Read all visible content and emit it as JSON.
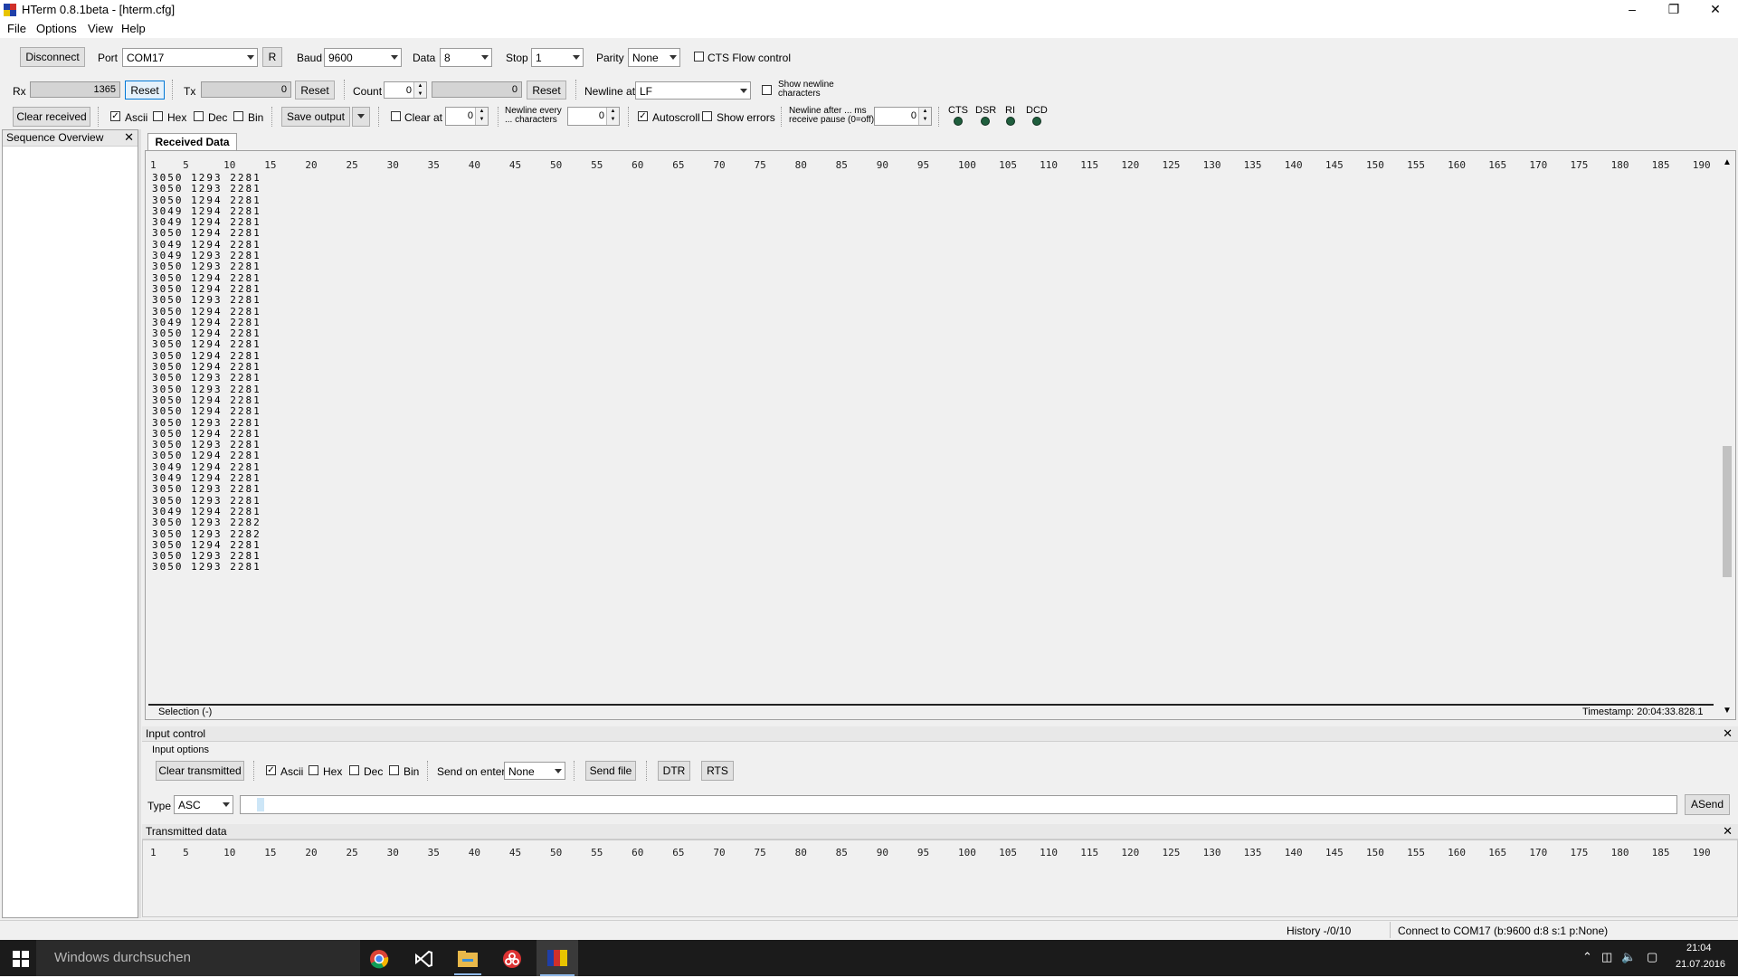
{
  "window": {
    "title": "HTerm 0.8.1beta - [hterm.cfg]"
  },
  "menu": [
    "File",
    "Options",
    "View",
    "Help"
  ],
  "toolbar1": {
    "disconnect_label": "Disconnect",
    "port_label": "Port",
    "port_value": "COM17",
    "r_label": "R",
    "baud_label": "Baud",
    "baud_value": "9600",
    "data_label": "Data",
    "data_value": "8",
    "stop_label": "Stop",
    "stop_value": "1",
    "parity_label": "Parity",
    "parity_value": "None",
    "cts_flow_label": "CTS Flow control"
  },
  "toolbar2": {
    "rx_label": "Rx",
    "rx_value": "1365",
    "reset_label": "Reset",
    "tx_label": "Tx",
    "tx_value": "0",
    "count_label": "Count",
    "count_value": "0",
    "count_field": "0",
    "newline_at_label": "Newline at",
    "newline_at_value": "LF",
    "show_newline_label": "Show newline characters"
  },
  "toolbar3": {
    "clear_received_label": "Clear received",
    "ascii_label": "Ascii",
    "hex_label": "Hex",
    "dec_label": "Dec",
    "bin_label": "Bin",
    "save_output_label": "Save output",
    "clear_at_label": "Clear at",
    "clear_at_value": "0",
    "newline_every_label": "Newline every ... characters",
    "newline_every_value": "0",
    "autoscroll_label": "Autoscroll",
    "show_errors_label": "Show errors",
    "newline_after_label": "Newline after ... ms receive pause (0=off)",
    "newline_after_value": "0",
    "signals": [
      "CTS",
      "DSR",
      "RI",
      "DCD"
    ]
  },
  "sequence_overview": {
    "title": "Sequence Overview"
  },
  "received": {
    "tab_label": "Received Data",
    "ruler": [
      "1",
      "5",
      "10",
      "15",
      "20",
      "25",
      "30",
      "35",
      "40",
      "45",
      "50",
      "55",
      "60",
      "65",
      "70",
      "75",
      "80",
      "85",
      "90",
      "95",
      "100",
      "105",
      "110",
      "115",
      "120",
      "125",
      "130",
      "135",
      "140",
      "145",
      "150",
      "155",
      "160",
      "165",
      "170",
      "175",
      "180",
      "185",
      "190"
    ],
    "lines": [
      "3050 1293 2281",
      "3050 1293 2281",
      "3050 1294 2281",
      "3049 1294 2281",
      "3049 1294 2281",
      "3050 1294 2281",
      "3049 1294 2281",
      "3049 1293 2281",
      "3050 1293 2281",
      "3050 1294 2281",
      "3050 1294 2281",
      "3050 1293 2281",
      "3050 1294 2281",
      "3049 1294 2281",
      "3050 1294 2281",
      "3050 1294 2281",
      "3050 1294 2281",
      "3050 1294 2281",
      "3050 1293 2281",
      "3050 1293 2281",
      "3050 1294 2281",
      "3050 1294 2281",
      "3050 1293 2281",
      "3050 1294 2281",
      "3050 1293 2281",
      "3050 1294 2281",
      "3049 1294 2281",
      "3049 1294 2281",
      "3050 1293 2281",
      "3050 1293 2281",
      "3049 1294 2281",
      "3050 1293 2282",
      "3050 1293 2282",
      "3050 1294 2281",
      "3050 1293 2281",
      "3050 1293 2281"
    ],
    "selection": "Selection (-)",
    "timestamp": "Timestamp: 20:04:33.828.1"
  },
  "input_control": {
    "title": "Input control",
    "options_label": "Input options",
    "clear_transmitted_label": "Clear transmitted",
    "ascii_label": "Ascii",
    "hex_label": "Hex",
    "dec_label": "Dec",
    "bin_label": "Bin",
    "send_on_enter_label": "Send on enter",
    "send_on_enter_value": "None",
    "send_file_label": "Send file",
    "dtr_label": "DTR",
    "rts_label": "RTS",
    "type_label": "Type",
    "type_value": "ASC",
    "asend_label": "ASend"
  },
  "transmitted": {
    "title": "Transmitted data",
    "ruler": [
      "1",
      "5",
      "10",
      "15",
      "20",
      "25",
      "30",
      "35",
      "40",
      "45",
      "50",
      "55",
      "60",
      "65",
      "70",
      "75",
      "80",
      "85",
      "90",
      "95",
      "100",
      "105",
      "110",
      "115",
      "120",
      "125",
      "130",
      "135",
      "140",
      "145",
      "150",
      "155",
      "160",
      "165",
      "170",
      "175",
      "180",
      "185",
      "190"
    ]
  },
  "statusbar": {
    "history": "History -/0/10",
    "connection": "Connect to COM17 (b:9600 d:8 s:1 p:None)"
  },
  "taskbar": {
    "search_placeholder": "Windows durchsuchen",
    "time": "21:04",
    "date": "21.07.2016"
  }
}
